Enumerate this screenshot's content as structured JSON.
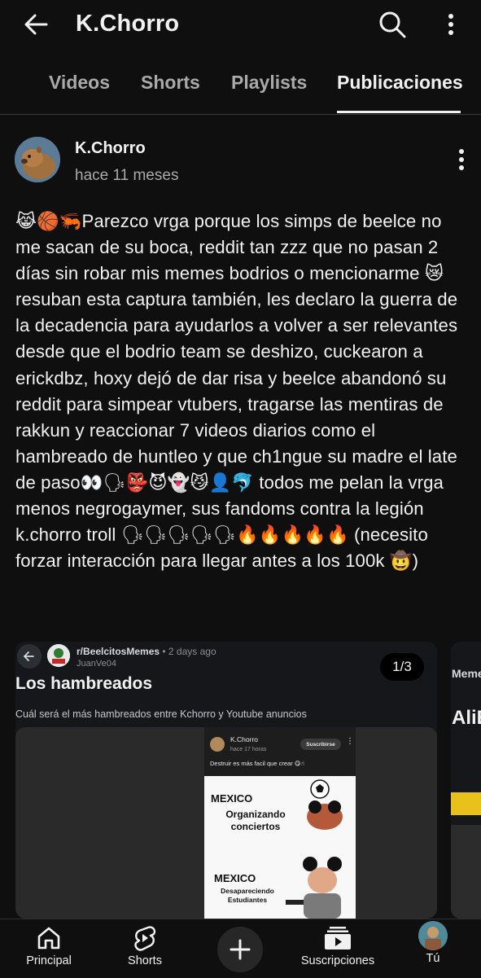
{
  "header": {
    "title": "K.Chorro",
    "back_icon": "arrow-left-icon",
    "search_icon": "search-icon",
    "more_icon": "more-vertical-icon"
  },
  "tabs": [
    {
      "label": "Videos",
      "active": false
    },
    {
      "label": "Shorts",
      "active": false
    },
    {
      "label": "Playlists",
      "active": false
    },
    {
      "label": "Publicaciones",
      "active": true
    }
  ],
  "post": {
    "author": "K.Chorro",
    "time": "hace 11 meses",
    "text": "😹🏀🦐Parezco vrga porque los simps de beelce no me sacan de su boca, reddit tan zzz que no pasan 2 días sin robar mis memes bodrios o mencionarme 😿 resuban esta captura también, les declaro la guerra de la decadencia para ayudarlos a volver a ser relevantes desde que el bodrio team se deshizo, cuckearon a erickdbz, hoxy dejó de dar risa y beelce abandonó su reddit para simpear vtubers, tragarse las mentiras de rakkun y reaccionar 7 videos diarios como el hambreado de huntleo y que ch1ngue su madre el late de paso👀🗣👺😈👻😼👤🐬 todos me pelan la vrga menos negrogaymer, sus fandoms contra la legión k.chorro troll 🗣🗣🗣🗣🗣🔥🔥🔥🔥🔥 (necesito forzar interacción para llegar antes a los 100k 🤠)"
  },
  "carousel": {
    "counter": "1/3",
    "slide1": {
      "subreddit": "r/BeelcitosMemes",
      "time": " • 2 days ago",
      "user": "JuanVe04",
      "title": "Los hambreados",
      "subtitle": "Cuál será el más hambreados entre Kchorro y Youtube anuncios",
      "screenshot": {
        "channel": "K.Chorro",
        "time": "hace 17 horas",
        "subscribe": "Suscribirse",
        "text": "Destruir es más facil que crear 😋☝",
        "meme_top_title": "MEXICO",
        "meme_top_caption": "Organizando conciertos",
        "meme_bottom_title": "MEXICO",
        "meme_bottom_caption": "Desapareciendo Estudiantes"
      }
    },
    "slide2": {
      "line1": "Meme",
      "line2": "AliE"
    }
  },
  "bottom_nav": [
    {
      "label": "Principal",
      "icon": "home-icon"
    },
    {
      "label": "Shorts",
      "icon": "shorts-icon"
    },
    {
      "label": "",
      "icon": "plus-icon"
    },
    {
      "label": "Suscripciones",
      "icon": "subscriptions-icon"
    },
    {
      "label": "Tú",
      "icon": "avatar-icon"
    }
  ]
}
